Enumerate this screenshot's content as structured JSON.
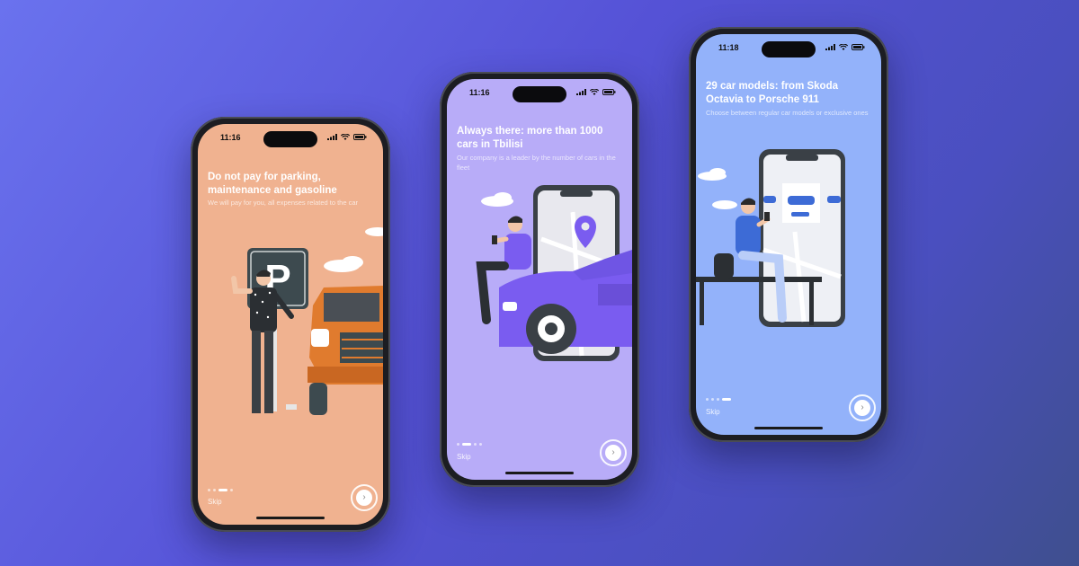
{
  "colors": {
    "screen1": "#f0b290",
    "screen2": "#b8acf8",
    "screen3": "#93b2fa"
  },
  "screens": [
    {
      "time": "11:16",
      "title": "Do not pay for parking, maintenance and gasoline",
      "subtitle": "We will pay for you, all expenses related to the car",
      "skip": "Skip",
      "next_icon": "›"
    },
    {
      "time": "11:16",
      "title": "Always there: more than 1000 cars in Tbilisi",
      "subtitle": "Our company is a leader by the number of cars in the fleet",
      "skip": "Skip",
      "next_icon": "›"
    },
    {
      "time": "11:18",
      "title": "29 car models: from Skoda Octavia to Porsche 911",
      "subtitle": "Choose between regular car models or exclusive ones",
      "skip": "Skip",
      "next_icon": "›"
    }
  ],
  "icons": [
    "signal-icon",
    "wifi-icon",
    "battery-icon",
    "parking-sign-icon",
    "location-pin-icon",
    "chevron-right-icon"
  ]
}
